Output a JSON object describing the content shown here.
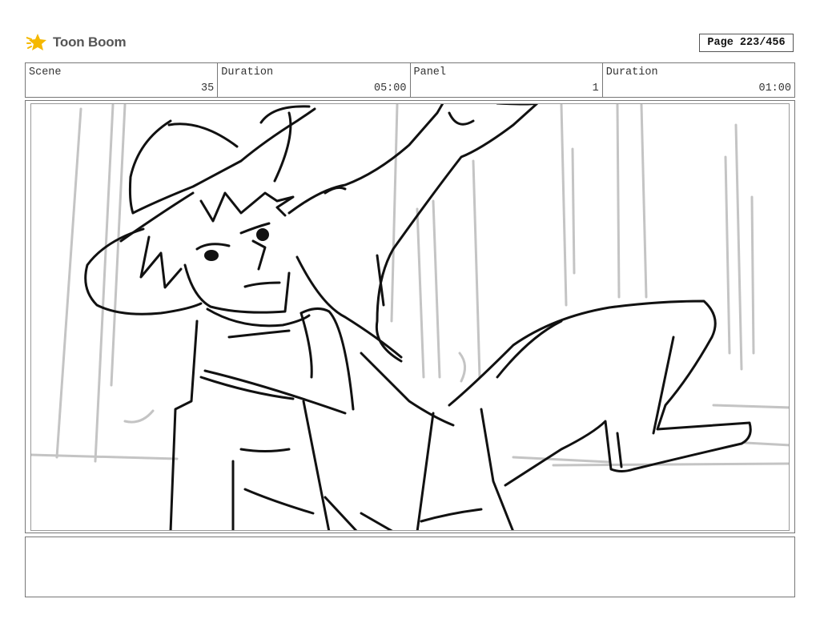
{
  "brand": {
    "name": "Toon Boom",
    "icon": "toon-boom-star-icon",
    "accent": "#F5B800"
  },
  "page_indicator": "Page 223/456",
  "info": [
    {
      "label": "Scene",
      "value": "35"
    },
    {
      "label": "Duration",
      "value": "05:00"
    },
    {
      "label": "Panel",
      "value": "1"
    },
    {
      "label": "Duration",
      "value": "01:00"
    }
  ],
  "panel": {
    "image": "sketch of a character in a wide-brimmed hat falling backwards with arm raised"
  },
  "notes": ""
}
